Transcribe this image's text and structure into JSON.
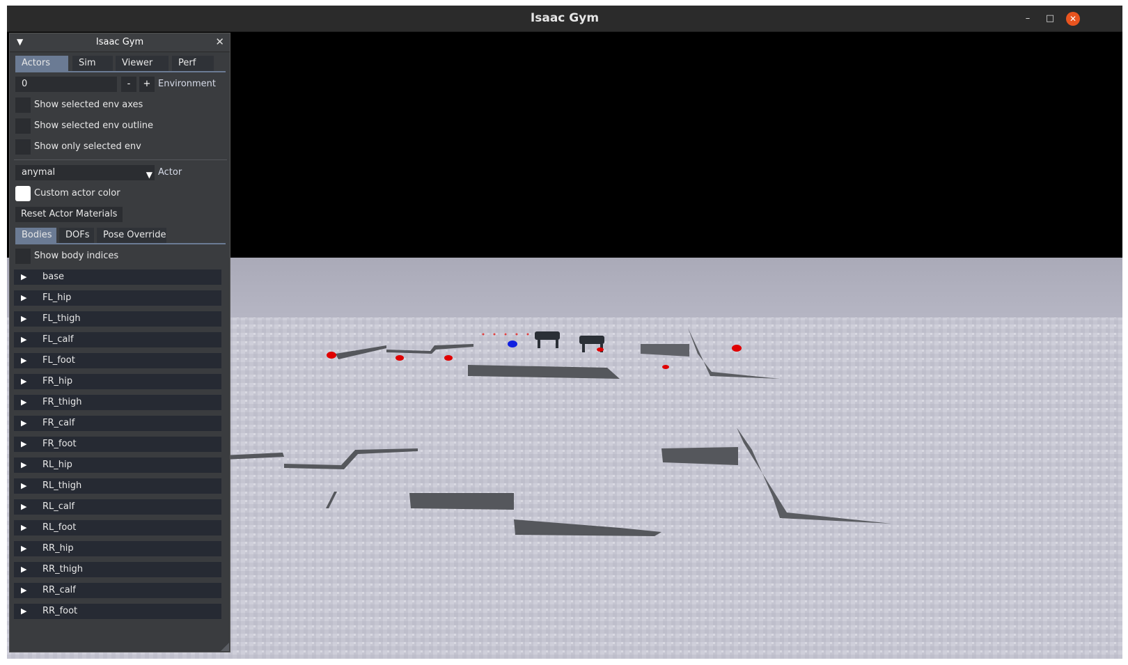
{
  "window": {
    "title": "Isaac Gym"
  },
  "panel": {
    "title": "Isaac Gym",
    "tabs": [
      "Actors",
      "Sim",
      "Viewer",
      "Perf"
    ],
    "env_value": "0",
    "minus": "-",
    "plus": "+",
    "env_label": "Environment",
    "checks": [
      "Show selected env axes",
      "Show selected env outline",
      "Show only selected env"
    ],
    "actor_value": "anymal",
    "actor_label": "Actor",
    "custom_color": "Custom actor color",
    "reset": "Reset Actor Materials",
    "subtabs": [
      "Bodies",
      "DOFs",
      "Pose Override"
    ],
    "show_indices": "Show body indices",
    "bodies": [
      "base",
      "FL_hip",
      "FL_thigh",
      "FL_calf",
      "FL_foot",
      "FR_hip",
      "FR_thigh",
      "FR_calf",
      "FR_foot",
      "RL_hip",
      "RL_thigh",
      "RL_calf",
      "RL_foot",
      "RR_hip",
      "RR_thigh",
      "RR_calf",
      "RR_foot"
    ]
  },
  "colors": {
    "accent": "#6b7b94",
    "terrain": "#c9c9d4",
    "marker_red": "#e00000",
    "marker_blue": "#1020e0"
  }
}
